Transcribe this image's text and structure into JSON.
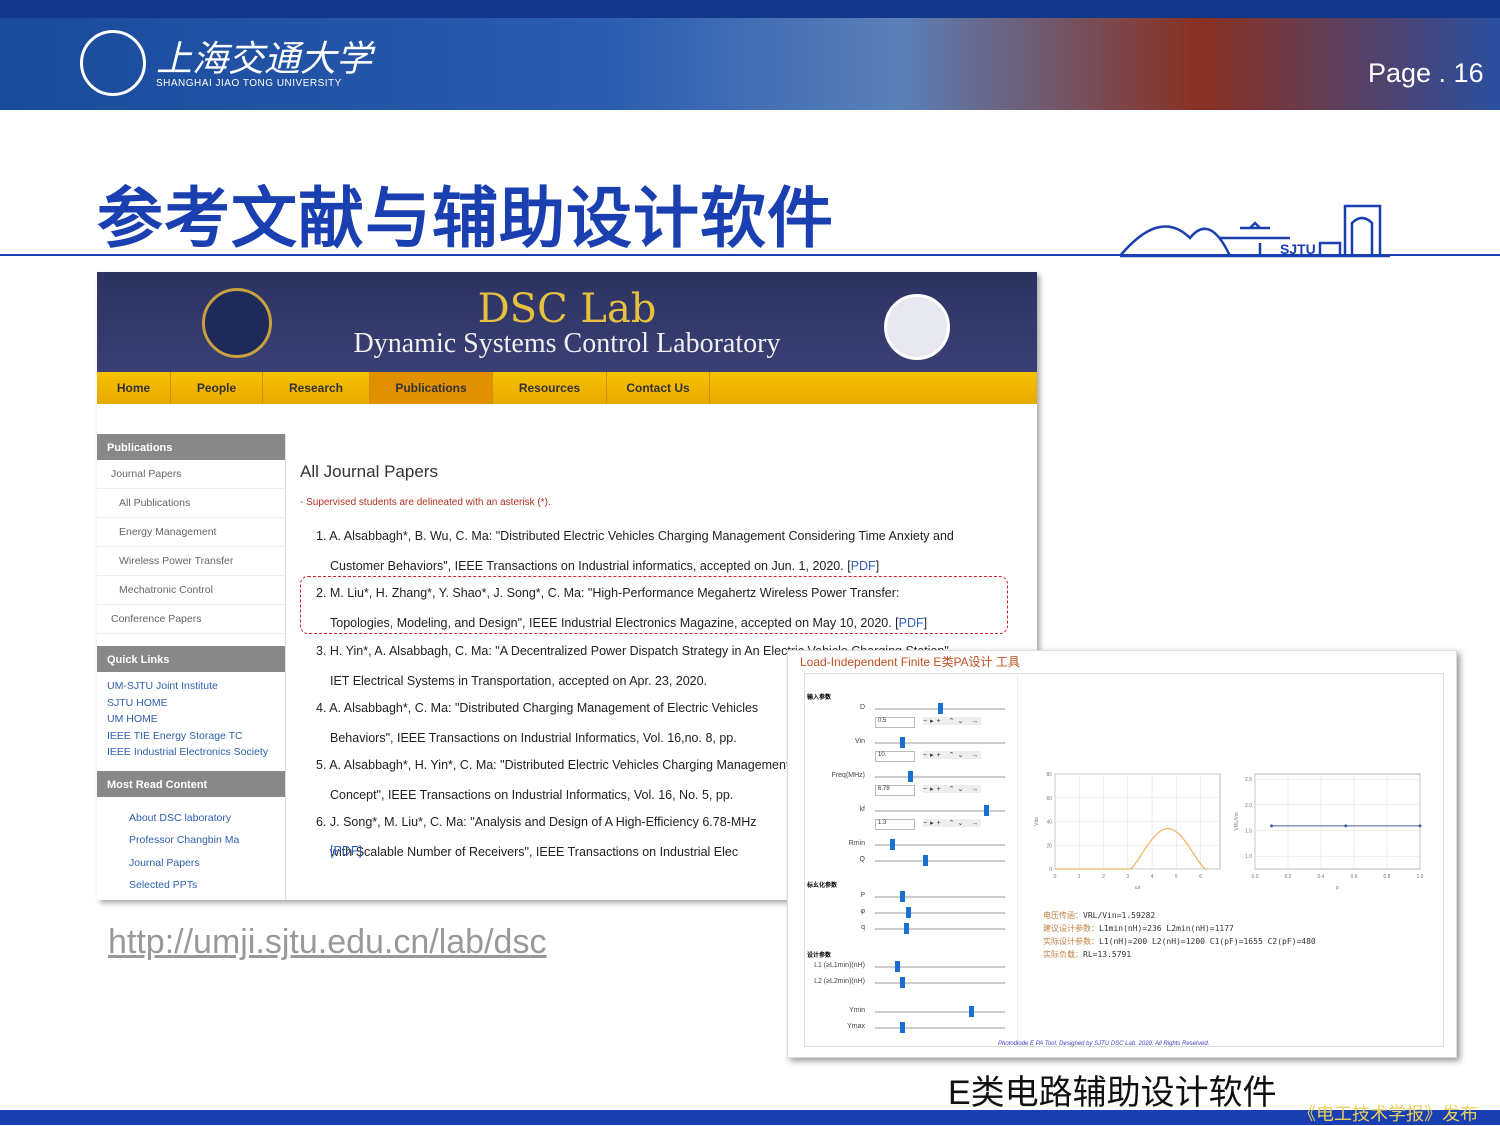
{
  "header": {
    "university_cn": "上海交通大学",
    "university_en": "SHANGHAI JIAO TONG UNIVERSITY",
    "page": "Page . 16",
    "skyline_text": "SJTU"
  },
  "slide_title": "参考文献与辅助设计软件",
  "website": {
    "lab_title": "DSC Lab",
    "lab_subtitle": "Dynamic Systems Control Laboratory",
    "nav": [
      "Home",
      "People",
      "Research",
      "Publications",
      "Resources",
      "Contact Us"
    ],
    "active_nav": "Publications",
    "sidebar": {
      "header": "Publications",
      "items": [
        "Journal Papers",
        "All Publications",
        "Energy Management",
        "Wireless Power Transfer",
        "Mechatronic Control",
        "Conference Papers"
      ],
      "quick_links_header": "Quick Links",
      "quick_links": [
        "UM-SJTU Joint Institute",
        "SJTU HOME",
        "UM HOME",
        "IEEE TIE Energy Storage TC",
        "IEEE Industrial Electronics Society"
      ],
      "most_read_header": "Most Read Content",
      "most_read": [
        "About DSC laboratory",
        "Professor Changbin Ma",
        "Journal Papers",
        "Selected PPTs"
      ]
    },
    "main_heading": "All Journal Papers",
    "note": "- Supervised students are delineated with an asterisk (*).",
    "refs": [
      [
        "1. A. Alsabbagh*, B. Wu, C. Ma: \"Distributed Electric Vehicles Charging Management Considering Time Anxiety and",
        "Customer Behaviors\", IEEE Transactions on Industrial informatics, accepted on Jun. 1, 2020. [",
        "PDF",
        "]"
      ],
      [
        "2. M. Liu*, H. Zhang*, Y. Shao*, J. Song*, C. Ma: \"High-Performance Megahertz Wireless Power Transfer:",
        "Topologies, Modeling, and Design\", IEEE Industrial Electronics Magazine, accepted on May 10, 2020. [",
        "PDF",
        "]"
      ],
      [
        "3. H. Yin*, A. Alsabbagh, C. Ma: \"A Decentralized Power Dispatch Strategy in An Electric Vehicle Charging Station\",",
        "IET Electrical Systems in Transportation, accepted on Apr. 23, 2020.",
        "",
        ""
      ],
      [
        "4. A. Alsabbagh*, C. Ma: \"Distributed Charging Management of Electric Vehicles",
        "Behaviors\", IEEE Transactions on Industrial Informatics, Vol. 16,no. 8, pp.",
        "",
        ""
      ],
      [
        "5. A. Alsabbagh*, H. Yin*, C. Ma: \"Distributed Electric Vehicles Charging Management",
        "Concept\", IEEE Transactions on Industrial Informatics,  Vol. 16, No. 5, pp.",
        "",
        ""
      ],
      [
        "6. J. Song*, M. Liu*, C. Ma: \"Analysis and Design of A High-Efficiency 6.78-MHz",
        "with Scalable Number of Receivers\", IEEE Transactions on Industrial Elec",
        "",
        ""
      ]
    ],
    "trailing_pdf": "[PDF]",
    "url": "http://umji.sjtu.edu.cn/lab/dsc"
  },
  "tool": {
    "title": "Load-Independent Finite E类PA设计 工具",
    "section1": "输入参数",
    "section2": "标幺化参数",
    "section3": "设计参数",
    "controls": [
      {
        "label": "D",
        "value": "0.5",
        "pos": 0.5
      },
      {
        "label": "Vin",
        "value": "10.",
        "pos": 0.2
      },
      {
        "label": "Freq(MHz)",
        "value": "6.78",
        "pos": 0.26
      },
      {
        "label": "kf",
        "value": "1.3",
        "pos": 0.87
      },
      {
        "label": "Rmin",
        "pos": 0.12
      },
      {
        "label": "Q",
        "pos": 0.38
      }
    ],
    "norm_controls": [
      {
        "label": "P",
        "pos": 0.2
      },
      {
        "label": "φ",
        "pos": 0.25
      },
      {
        "label": "q",
        "pos": 0.23
      }
    ],
    "design_controls": [
      {
        "label": "L1 (≥L1min)(nH)",
        "pos": 0.16
      },
      {
        "label": "L2 (≥L2min)(nH)",
        "pos": 0.2
      },
      {
        "label": "Ymin",
        "pos": 0.75
      },
      {
        "label": "Ymax",
        "pos": 0.2
      }
    ],
    "chart1": {
      "ylabel": "Vds",
      "xlabel": "ωt",
      "yticks": [
        "0",
        "20",
        "40",
        "60",
        "80"
      ],
      "xticks": [
        "0",
        "1",
        "2",
        "3",
        "4",
        "5",
        "6"
      ],
      "color": "#f0a040"
    },
    "chart2": {
      "ylabel": "VRL/Vin",
      "xlabel": "p",
      "yticks": [
        "1.0",
        "1.5",
        "2.0",
        "2.5"
      ],
      "xticks": [
        "0.0",
        "0.2",
        "0.4",
        "0.6",
        "0.8",
        "1.0"
      ],
      "value": 1.59,
      "color": "#4060a0"
    },
    "results": [
      {
        "label": "电压传函：",
        "value": "VRL/Vin=1.59282"
      },
      {
        "label": "建议设计参数：",
        "value": "L1min(nH)=236   L2min(nH)=1177"
      },
      {
        "label": "实际设计参数：",
        "value": "L1(nH)=200  L2(nH)=1200  C1(pF)=1655  C2(pF)=480"
      },
      {
        "label": "实际负载：",
        "value": "RL=13.5791"
      }
    ],
    "footer": "Photodiode E PA Tool. Designed by SJTU DSC Lab. 2020. All Rights Reserved."
  },
  "caption": "E类电路辅助设计软件",
  "watermark": "《电工技术学报》发布"
}
